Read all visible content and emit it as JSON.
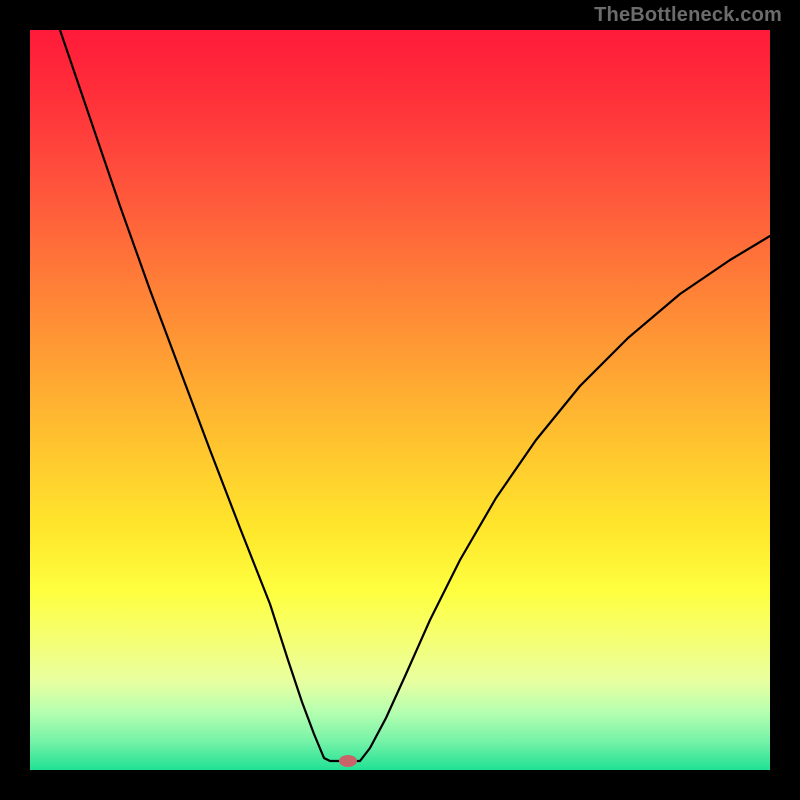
{
  "watermark": "TheBottleneck.com",
  "colors": {
    "frame": "#000000",
    "watermark_text": "#6c6c6c",
    "curve_stroke": "#000000",
    "marker_fill": "#c9636a",
    "gradient_stops": [
      "#ff1a3a",
      "#ff2d3a",
      "#ff4a3c",
      "#ff6a3a",
      "#ff8a36",
      "#ffaa32",
      "#ffca2e",
      "#ffe82c",
      "#feff40",
      "#f6ff70",
      "#e8ffa0",
      "#b8ffb0",
      "#78f3a8",
      "#1fe194"
    ]
  },
  "chart_data": {
    "type": "line",
    "title": "",
    "xlabel": "",
    "ylabel": "",
    "xlim": [
      0,
      740
    ],
    "ylim_note": "y is plotted downward (screen space); 0 = top, 740 = bottom",
    "series": [
      {
        "name": "left-branch",
        "x": [
          30,
          60,
          90,
          120,
          150,
          180,
          210,
          240,
          258,
          272,
          284,
          294,
          300
        ],
        "y": [
          0,
          88,
          176,
          260,
          340,
          420,
          498,
          574,
          630,
          672,
          704,
          728,
          731
        ]
      },
      {
        "name": "valley-floor",
        "x": [
          300,
          310,
          320,
          330
        ],
        "y": [
          731,
          731,
          731,
          731
        ]
      },
      {
        "name": "right-branch",
        "x": [
          330,
          340,
          356,
          376,
          400,
          430,
          466,
          506,
          550,
          598,
          650,
          700,
          740
        ],
        "y": [
          731,
          718,
          688,
          644,
          590,
          530,
          468,
          410,
          356,
          308,
          264,
          230,
          206
        ]
      }
    ],
    "marker": {
      "name": "min-point",
      "cx": 318,
      "cy": 731,
      "rx": 9,
      "ry": 6
    }
  }
}
